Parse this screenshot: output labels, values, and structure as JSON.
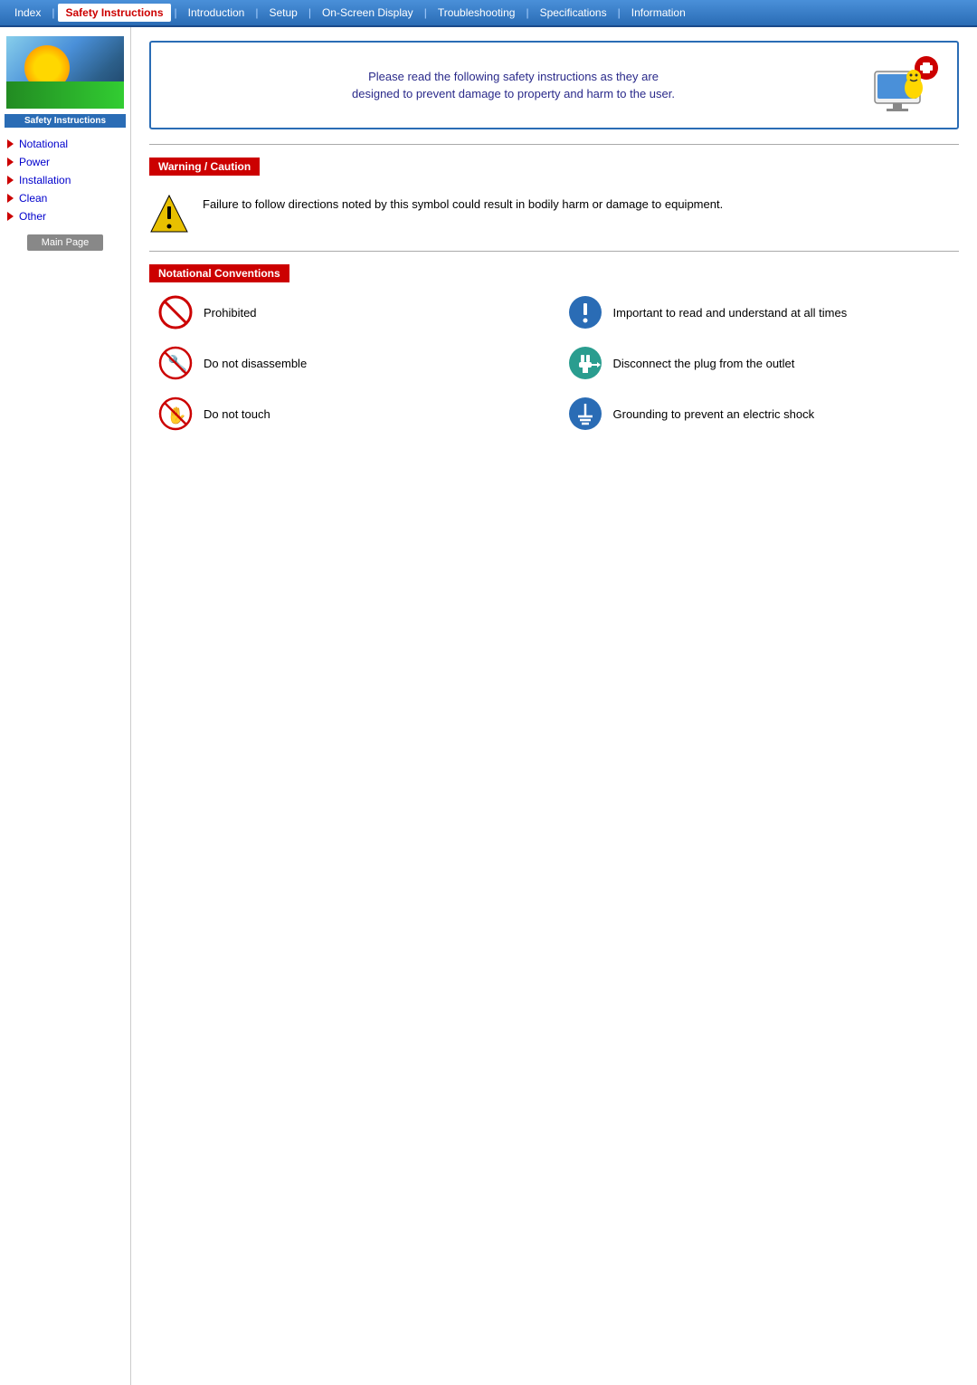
{
  "navbar": {
    "items": [
      {
        "label": "Index",
        "active": false
      },
      {
        "label": "Safety Instructions",
        "active": true
      },
      {
        "label": "Introduction",
        "active": false
      },
      {
        "label": "Setup",
        "active": false
      },
      {
        "label": "On-Screen Display",
        "active": false
      },
      {
        "label": "Troubleshooting",
        "active": false
      },
      {
        "label": "Specifications",
        "active": false
      },
      {
        "label": "Information",
        "active": false
      }
    ]
  },
  "sidebar": {
    "logo_label": "Safety Instructions",
    "links": [
      {
        "label": "Notational",
        "href": "#"
      },
      {
        "label": "Power",
        "href": "#"
      },
      {
        "label": "Installation",
        "href": "#"
      },
      {
        "label": "Clean",
        "href": "#"
      },
      {
        "label": "Other",
        "href": "#"
      }
    ],
    "main_page_btn": "Main Page"
  },
  "intro": {
    "text_line1": "Please read the following safety instructions as they are",
    "text_line2": "designed to prevent damage to property and harm to the user."
  },
  "warning": {
    "section_label": "Warning / Caution",
    "text": "Failure to follow directions noted by this symbol could result in bodily harm or damage to equipment."
  },
  "notational": {
    "section_label": "Notational Conventions",
    "items": [
      {
        "label": "Prohibited",
        "icon": "prohibited"
      },
      {
        "label": "Important to read and understand at all times",
        "icon": "important"
      },
      {
        "label": "Do not disassemble",
        "icon": "no-disassemble"
      },
      {
        "label": "Disconnect the plug from the outlet",
        "icon": "disconnect"
      },
      {
        "label": "Do not touch",
        "icon": "no-touch"
      },
      {
        "label": "Grounding to prevent an electric shock",
        "icon": "grounding"
      }
    ]
  }
}
